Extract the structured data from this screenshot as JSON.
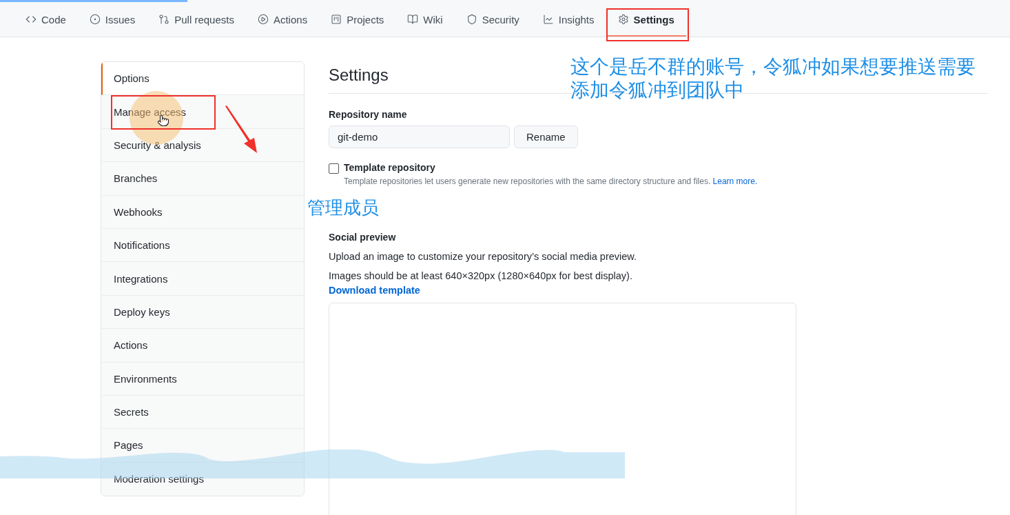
{
  "nav": {
    "tabs": [
      {
        "label": "Code",
        "selected": false
      },
      {
        "label": "Issues",
        "selected": false
      },
      {
        "label": "Pull requests",
        "selected": false
      },
      {
        "label": "Actions",
        "selected": false
      },
      {
        "label": "Projects",
        "selected": false
      },
      {
        "label": "Wiki",
        "selected": false
      },
      {
        "label": "Security",
        "selected": false
      },
      {
        "label": "Insights",
        "selected": false
      },
      {
        "label": "Settings",
        "selected": true
      }
    ]
  },
  "sidebar": {
    "items": [
      {
        "label": "Options",
        "selected": true
      },
      {
        "label": "Manage access",
        "selected": false
      },
      {
        "label": "Security & analysis",
        "selected": false
      },
      {
        "label": "Branches",
        "selected": false
      },
      {
        "label": "Webhooks",
        "selected": false
      },
      {
        "label": "Notifications",
        "selected": false
      },
      {
        "label": "Integrations",
        "selected": false
      },
      {
        "label": "Deploy keys",
        "selected": false
      },
      {
        "label": "Actions",
        "selected": false
      },
      {
        "label": "Environments",
        "selected": false
      },
      {
        "label": "Secrets",
        "selected": false
      },
      {
        "label": "Pages",
        "selected": false
      },
      {
        "label": "Moderation settings",
        "selected": false
      }
    ]
  },
  "main": {
    "title": "Settings",
    "repository_name": {
      "label": "Repository name",
      "value": "git-demo",
      "button": "Rename"
    },
    "template": {
      "label": "Template repository",
      "checked": false,
      "description": "Template repositories let users generate new repositories with the same directory structure and files.",
      "link": "Learn more."
    },
    "social_preview": {
      "heading": "Social preview",
      "text": "Upload an image to customize your repository’s social media preview.",
      "hint": "Images should be at least 640×320px (1280×640px for best display).",
      "link": "Download template"
    }
  },
  "annotations": {
    "note": "这个是岳不群的账号，令狐冲如果想要推送需要添加令狐冲到团队中",
    "callout": "管理成员"
  }
}
